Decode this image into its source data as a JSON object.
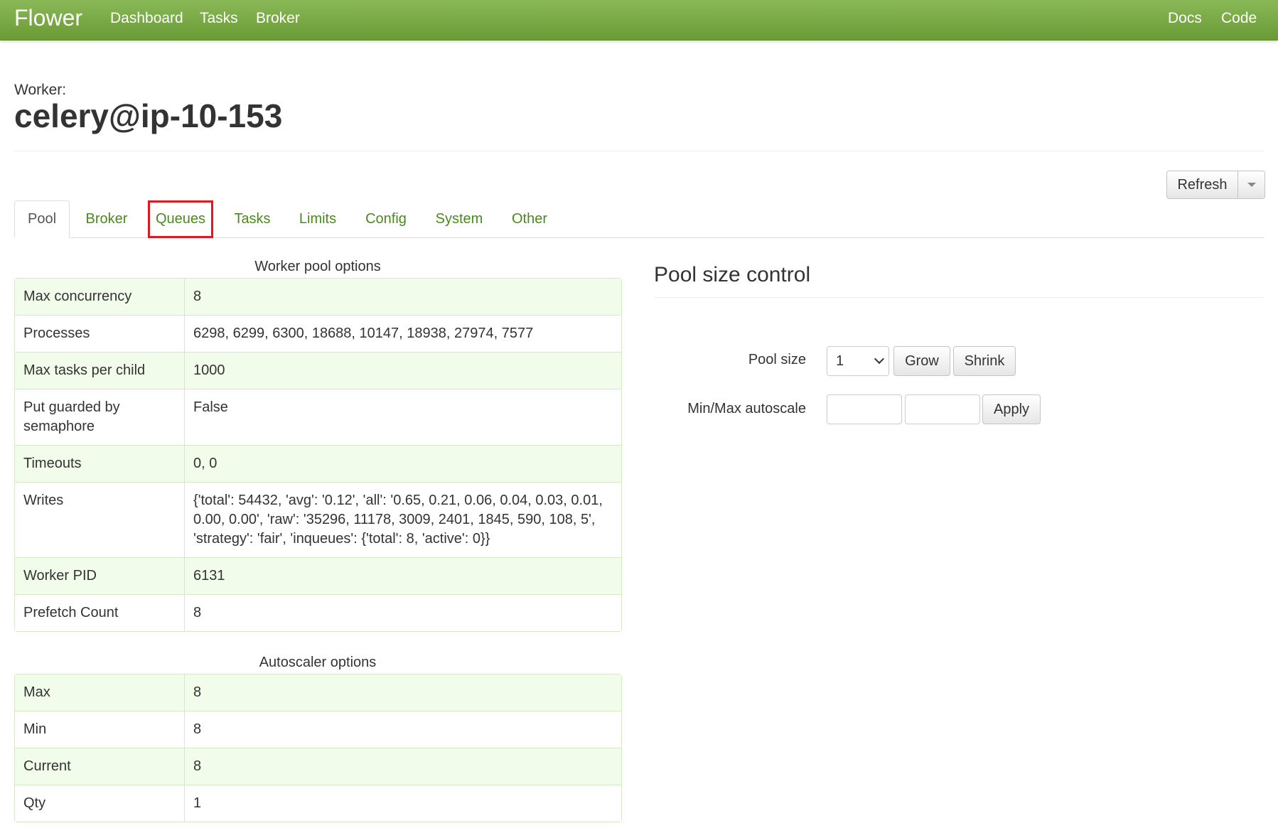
{
  "navbar": {
    "brand": "Flower",
    "links": [
      "Dashboard",
      "Tasks",
      "Broker"
    ],
    "right_links": [
      "Docs",
      "Code"
    ]
  },
  "header": {
    "label": "Worker:",
    "worker_name": "celery@ip-10-153"
  },
  "toolbar": {
    "refresh_label": "Refresh",
    "dropdown_icon": "caret-down-icon"
  },
  "tabs": [
    {
      "label": "Pool",
      "active": true
    },
    {
      "label": "Broker"
    },
    {
      "label": "Queues",
      "highlighted": true
    },
    {
      "label": "Tasks"
    },
    {
      "label": "Limits"
    },
    {
      "label": "Config"
    },
    {
      "label": "System"
    },
    {
      "label": "Other"
    }
  ],
  "pool_options": {
    "caption": "Worker pool options",
    "rows": [
      {
        "key": "Max concurrency",
        "value": "8"
      },
      {
        "key": "Processes",
        "value": "6298, 6299, 6300, 18688, 10147, 18938, 27974, 7577"
      },
      {
        "key": "Max tasks per child",
        "value": "1000"
      },
      {
        "key": "Put guarded by semaphore",
        "value": "False"
      },
      {
        "key": "Timeouts",
        "value": "0, 0"
      },
      {
        "key": "Writes",
        "value": "{'total': 54432, 'avg': '0.12', 'all': '0.65, 0.21, 0.06, 0.04, 0.03, 0.01, 0.00, 0.00', 'raw': '35296, 11178, 3009, 2401, 1845, 590, 108, 5', 'strategy': 'fair', 'inqueues': {'total': 8, 'active': 0}}"
      },
      {
        "key": "Worker PID",
        "value": "6131"
      },
      {
        "key": "Prefetch Count",
        "value": "8"
      }
    ]
  },
  "autoscaler_options": {
    "caption": "Autoscaler options",
    "rows": [
      {
        "key": "Max",
        "value": "8"
      },
      {
        "key": "Min",
        "value": "8"
      },
      {
        "key": "Current",
        "value": "8"
      },
      {
        "key": "Qty",
        "value": "1"
      }
    ]
  },
  "pool_control": {
    "title": "Pool size control",
    "pool_size_label": "Pool size",
    "pool_size_value": "1",
    "grow_label": "Grow",
    "shrink_label": "Shrink",
    "autoscale_label": "Min/Max autoscale",
    "min_value": "",
    "max_value": "",
    "apply_label": "Apply"
  },
  "colors": {
    "navbar": "#7aab46",
    "link": "#4a8a1c",
    "row_stripe": "#f1fcea",
    "highlight": "#e0181f"
  }
}
